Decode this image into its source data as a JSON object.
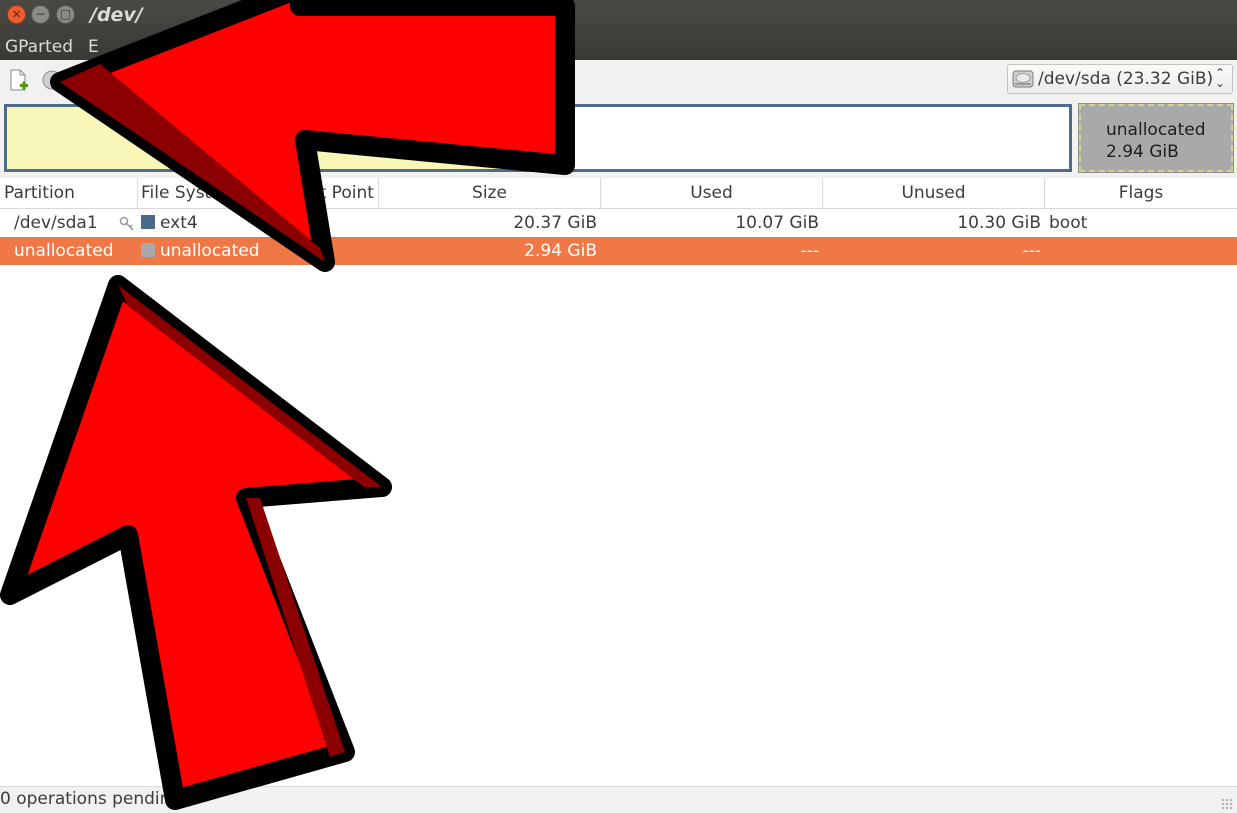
{
  "window": {
    "title": "/dev/",
    "controls": {
      "close": "×",
      "minimize": "−",
      "maximize": "□"
    }
  },
  "menubar": {
    "items": [
      "GParted",
      "E"
    ]
  },
  "toolbar": {
    "icons": [
      "new-partition-icon",
      "delete-partition-icon"
    ],
    "device_selector": {
      "value": "/dev/sda  (23.32 GiB)",
      "icon": "hard-disk-icon",
      "arrows": "⌃⌄"
    }
  },
  "disk_map": {
    "partitions": [
      {
        "name": "/dev/sda1",
        "fs": "ext4",
        "used_fraction": 0.49
      },
      {
        "label": "unallocated",
        "size": "2.94 GiB"
      }
    ]
  },
  "table": {
    "columns": [
      "Partition",
      "File System",
      "Mount Point",
      "Size",
      "Used",
      "Unused",
      "Flags"
    ],
    "rows": [
      {
        "partition": "/dev/sda1",
        "filesystem": "ext4",
        "fs_color": "#4a6a8a",
        "mount": "",
        "size": "20.37 GiB",
        "used": "10.07 GiB",
        "unused": "10.30 GiB",
        "flags": "boot",
        "icon": "key-icon",
        "selected": false
      },
      {
        "partition": "unallocated",
        "filesystem": "unallocated",
        "fs_color": "#a9a9a9",
        "mount": "",
        "size": "2.94 GiB",
        "used": "---",
        "unused": "---",
        "flags": "",
        "selected": true
      }
    ]
  },
  "status": {
    "text": "0 operations pending"
  },
  "colors": {
    "selection": "#f07746",
    "arrow_fill": "#ff0000",
    "arrow_shadow": "#8b0000",
    "arrow_outline": "#000000"
  },
  "annotations": [
    "red-arrow-pointing-up-left",
    "red-arrow-pointing-up"
  ]
}
